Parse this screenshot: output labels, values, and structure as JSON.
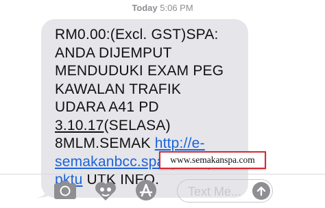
{
  "header": {
    "day": "Today",
    "time": "5:06 PM"
  },
  "message": {
    "lines": [
      "RM0.00:(Excl. GST)SPA:",
      "ANDA DIJEMPUT",
      "MENDUDUKI EXAM PEG",
      "KAWALAN TRAFIK",
      "UDARA A41 PD"
    ],
    "date_text": "3.10.17",
    "date_suffix": "(SELASA)",
    "line7_prefix": "8MLM.SEMAK ",
    "link_part1": "http://e-",
    "link_part2": "semakanbcc.spa.gov.my/",
    "link_part3": "pktu",
    "line9_suffix": " UTK INFO."
  },
  "watermark": {
    "text": "www.semakanspa.com",
    "border_color": "#d6282f"
  },
  "toolbar": {
    "camera_icon": "camera-icon",
    "digital_touch_icon": "digital-touch-icon",
    "app_store_icon": "app-store-icon",
    "input_placeholder": "Text Me...",
    "send_icon": "send-arrow-icon"
  },
  "colors": {
    "bubble": "#e5e5ea",
    "link": "#1a63d9",
    "icon": "#8e8e93"
  }
}
